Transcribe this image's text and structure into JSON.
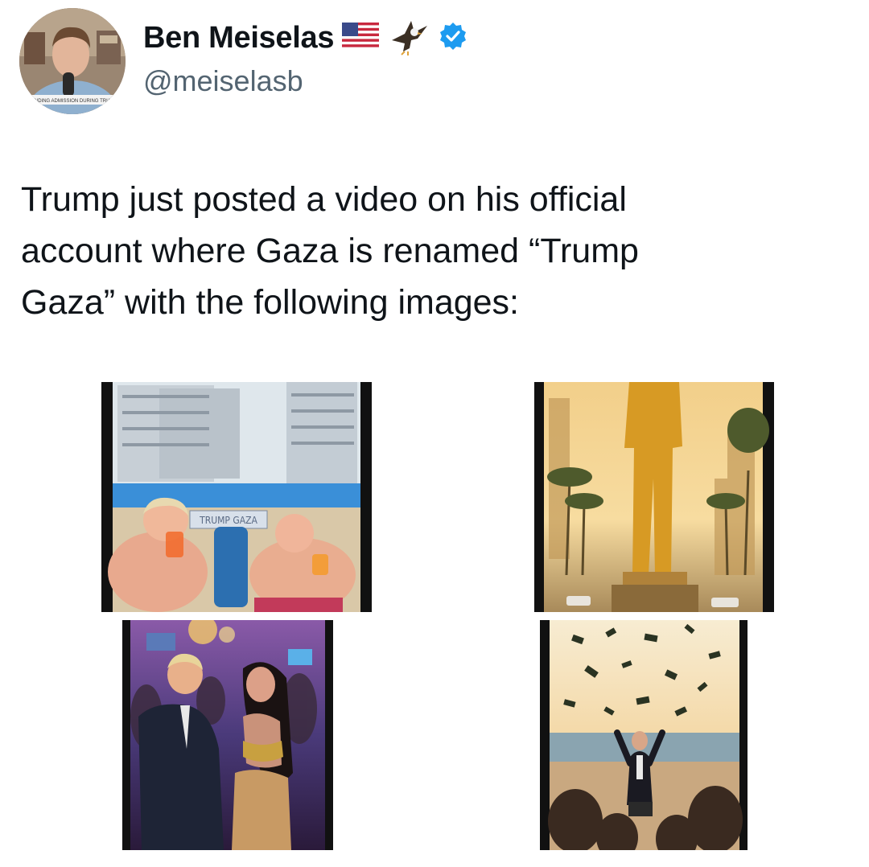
{
  "author": {
    "display_name": "Ben Meiselas",
    "handle": "@meiselasb",
    "name_badges": [
      "us-flag-icon",
      "eagle-icon",
      "verified-badge-icon"
    ],
    "verified_color": "#1d9bf0",
    "avatar_caption": "ENDING ADMISSION DURING TRIAL"
  },
  "tweet": {
    "text": "Trump just posted a video on his official\naccount where Gaza is renamed “Trump\nGaza” with the following images:"
  },
  "media": [
    {
      "caption": "TRUMP GAZA"
    },
    {},
    {},
    {}
  ]
}
